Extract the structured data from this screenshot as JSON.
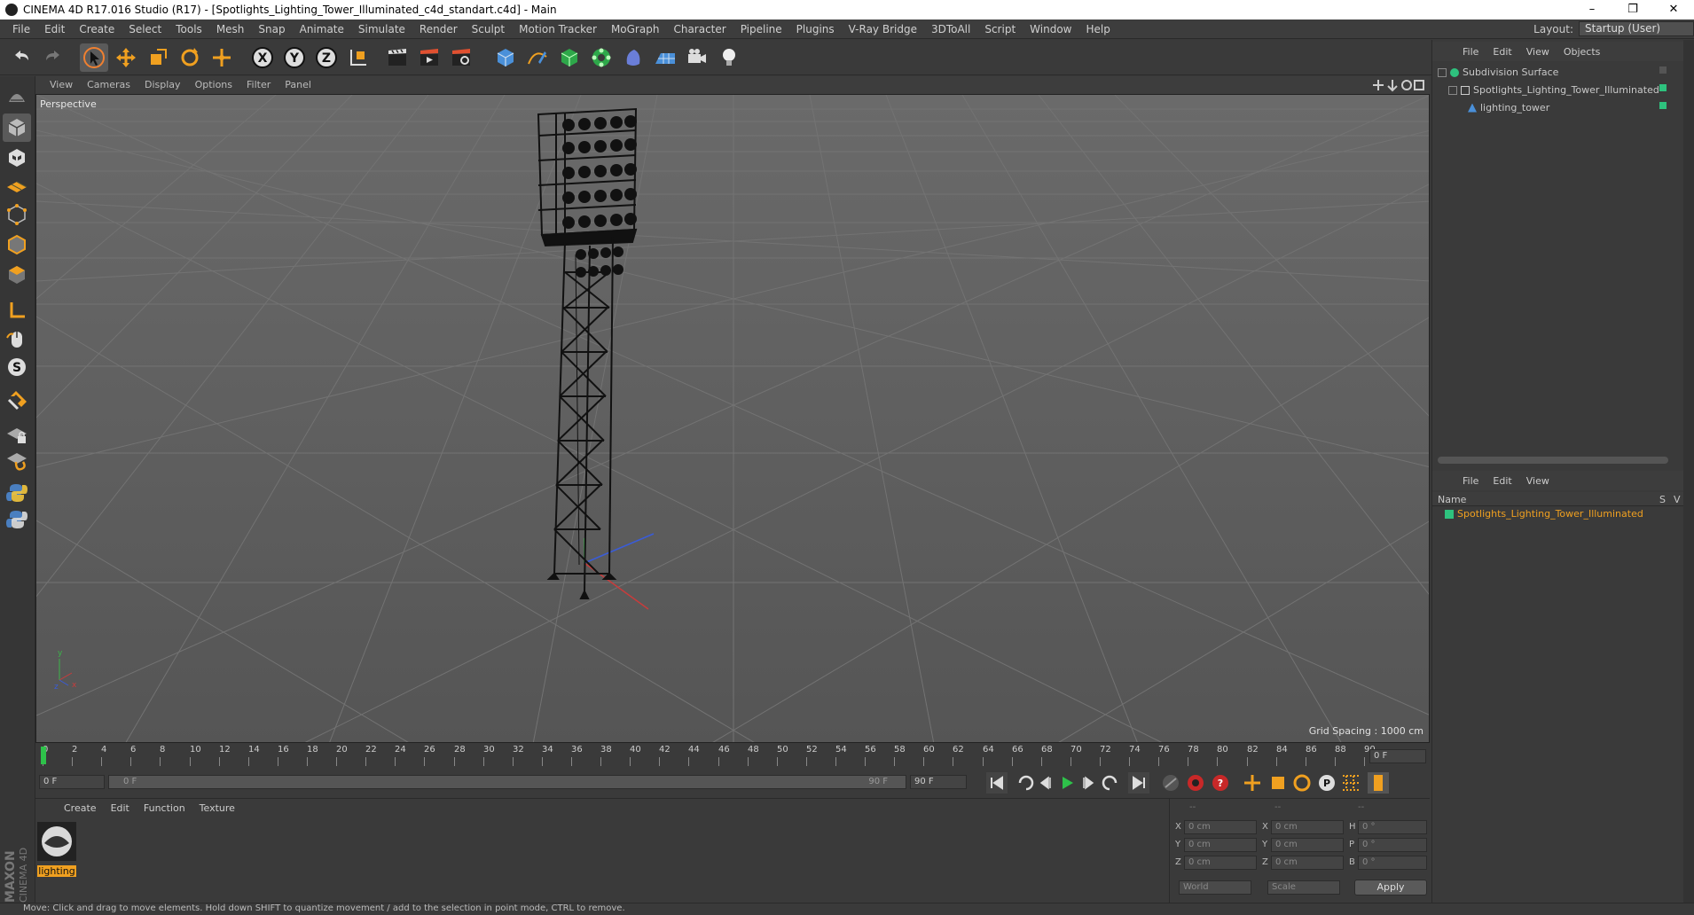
{
  "window": {
    "title": "CINEMA 4D R17.016 Studio (R17) - [Spotlights_Lighting_Tower_Illuminated_c4d_standart.c4d] - Main",
    "controls": [
      "–",
      "❐",
      "✕"
    ]
  },
  "menubar": {
    "items": [
      "File",
      "Edit",
      "Create",
      "Select",
      "Tools",
      "Mesh",
      "Snap",
      "Animate",
      "Simulate",
      "Render",
      "Sculpt",
      "Motion Tracker",
      "MoGraph",
      "Character",
      "Pipeline",
      "Plugins",
      "V-Ray Bridge",
      "3DToAll",
      "Script",
      "Window",
      "Help"
    ],
    "layout_label": "Layout:",
    "layout_value": "Startup (User)"
  },
  "viewport": {
    "menu": [
      "View",
      "Cameras",
      "Display",
      "Options",
      "Filter",
      "Panel"
    ],
    "camera_label": "Perspective",
    "grid_spacing": "Grid Spacing : 1000 cm"
  },
  "timeline": {
    "ticks": [
      "0",
      "2",
      "4",
      "6",
      "8",
      "10",
      "12",
      "14",
      "16",
      "18",
      "20",
      "22",
      "24",
      "26",
      "28",
      "30",
      "32",
      "34",
      "36",
      "38",
      "40",
      "42",
      "44",
      "46",
      "48",
      "50",
      "52",
      "54",
      "56",
      "58",
      "60",
      "62",
      "64",
      "66",
      "68",
      "70",
      "72",
      "74",
      "76",
      "78",
      "80",
      "82",
      "84",
      "86",
      "88",
      "90"
    ],
    "current_frame": "0 F",
    "start_frame": "0 F",
    "range_start": "0 F",
    "range_end": "90 F",
    "end_frame": "90 F"
  },
  "materials": {
    "menu": [
      "Create",
      "Edit",
      "Function",
      "Texture"
    ],
    "items": [
      {
        "name": "lighting"
      }
    ]
  },
  "coords": {
    "headers": [
      "--",
      "--",
      "--"
    ],
    "rows": [
      {
        "a": "X",
        "av": "0 cm",
        "b": "X",
        "bv": "0 cm",
        "c": "H",
        "cv": "0 °"
      },
      {
        "a": "Y",
        "av": "0 cm",
        "b": "Y",
        "bv": "0 cm",
        "c": "P",
        "cv": "0 °"
      },
      {
        "a": "Z",
        "av": "0 cm",
        "b": "Z",
        "bv": "0 cm",
        "c": "B",
        "cv": "0 °"
      }
    ],
    "world": "World",
    "scale": "Scale",
    "apply": "Apply"
  },
  "object_manager": {
    "menu": [
      "File",
      "Edit",
      "View",
      "Objects"
    ],
    "objects": [
      {
        "name": "Subdivision Surface",
        "color": "#d8d8d8"
      },
      {
        "name": "Spotlights_Lighting_Tower_Illuminated",
        "color": "#d8d8d8"
      },
      {
        "name": "lighting_tower",
        "color": "#d8d8d8"
      }
    ]
  },
  "attribute_manager": {
    "menu": [
      "File",
      "Edit",
      "View"
    ],
    "col_name": "Name",
    "col_s": "S",
    "col_v": "V",
    "rows": [
      {
        "name": "Spotlights_Lighting_Tower_Illuminated",
        "color": "#f0a020"
      }
    ]
  },
  "statusbar": {
    "text": "Move: Click and drag to move elements. Hold down SHIFT to quantize movement / add to the selection in point mode, CTRL to remove."
  },
  "colors": {
    "accent_orange": "#f0a020",
    "green_tag": "#2ec27e",
    "viewport_bg": "#5e5e5e"
  }
}
